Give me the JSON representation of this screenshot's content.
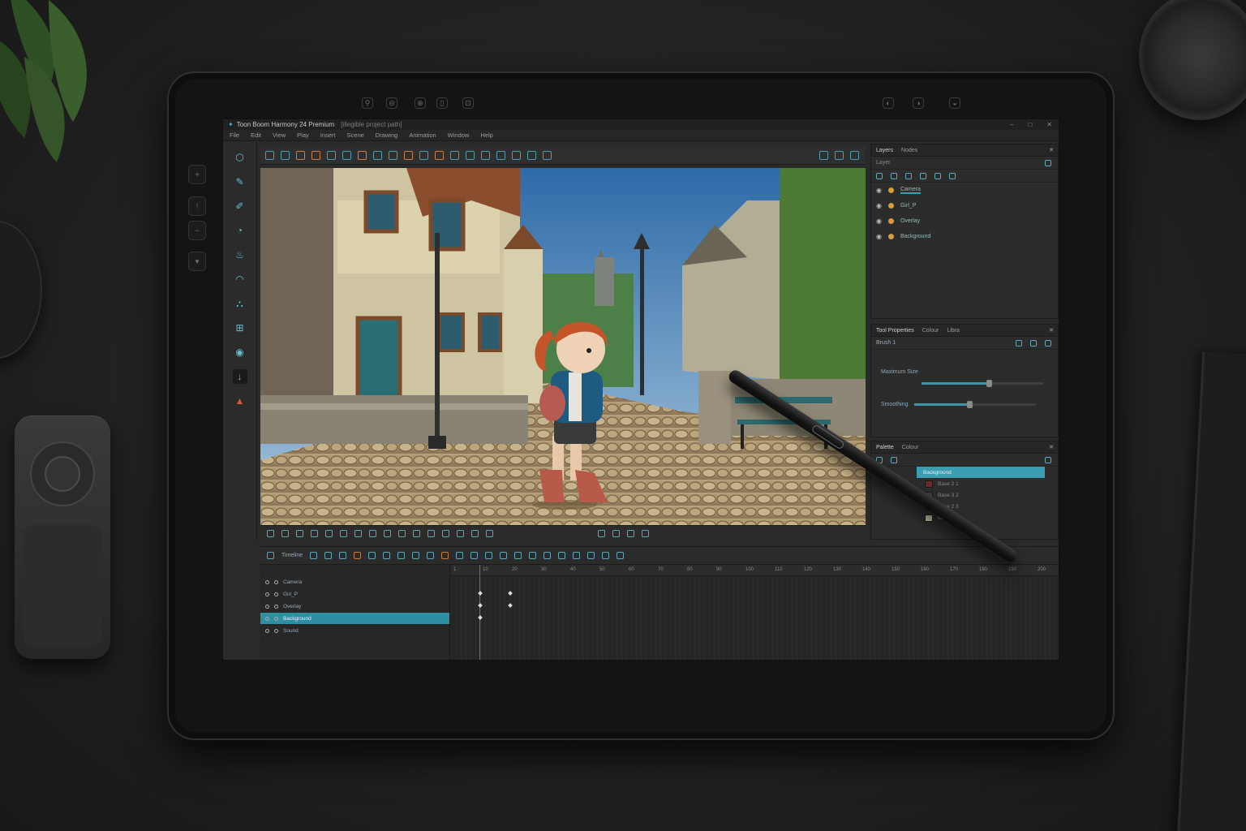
{
  "app": {
    "title": "Toon Boom Harmony 24 Premium",
    "subtitle": "[illegible project path]",
    "window_buttons": [
      "–",
      "□",
      "✕"
    ]
  },
  "menu": [
    "File",
    "Edit",
    "View",
    "Play",
    "Insert",
    "Scene",
    "Drawing",
    "Animation",
    "Window",
    "Help"
  ],
  "tablet_top_buttons": [
    "⚲",
    "⊖",
    "⊕",
    "▯",
    "⊡"
  ],
  "tablet_right_buttons": [
    "◐",
    "◑",
    "◒"
  ],
  "side_keys": [
    "+",
    "⁝",
    "−",
    "▾"
  ],
  "layers_panel": {
    "tabs": [
      "Layers",
      "Nodes"
    ],
    "search_placeholder": "Layer",
    "rows": [
      {
        "name": "Camera"
      },
      {
        "name": "Girl_P"
      },
      {
        "name": "Overlay"
      },
      {
        "name": "Background"
      }
    ]
  },
  "tool_properties": {
    "tabs": [
      "Tool Properties",
      "Colour",
      "Libra"
    ],
    "brush_label": "Brush 1",
    "maximum_size_label": "Maximum Size",
    "maximum_size": 0.55,
    "smoothing_label": "Smoothing",
    "smoothing": 0.45
  },
  "palette": {
    "tabs": [
      "Palette",
      "Colour"
    ],
    "rows": [
      {
        "name": "Background",
        "color": "#3a9db0"
      },
      {
        "name": "Base 2 1",
        "color": "#6a2a2a"
      },
      {
        "name": "Base 3 2",
        "color": "#3a3a3a"
      },
      {
        "name": "Base 2 3",
        "color": "#2e2e2e"
      },
      {
        "name": "Base 3 4",
        "color": "#c8c2a8"
      }
    ]
  },
  "timeline": {
    "toolbar_label": "Timeline",
    "layers": [
      {
        "name": "Camera",
        "selected": false
      },
      {
        "name": "Girl_P",
        "selected": false
      },
      {
        "name": "Overlay",
        "selected": false
      },
      {
        "name": "Background",
        "selected": true
      },
      {
        "name": "Sound",
        "selected": false
      }
    ],
    "ruler": [
      "1",
      "10",
      "20",
      "30",
      "40",
      "50",
      "60",
      "70",
      "80",
      "90",
      "100",
      "110",
      "120",
      "130",
      "140",
      "150",
      "160",
      "170",
      "180",
      "190",
      "200"
    ]
  },
  "colors": {
    "accent": "#3a9db0",
    "playhead": "#d04a3a"
  }
}
